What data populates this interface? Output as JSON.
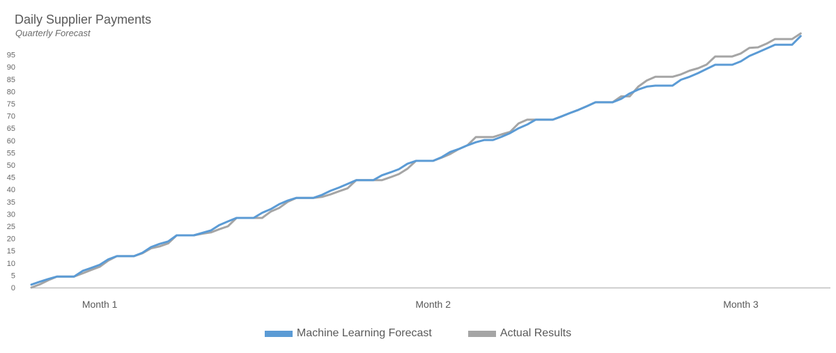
{
  "chart_data": {
    "type": "line",
    "title": "Daily Supplier Payments",
    "subtitle": "Quarterly Forecast",
    "xlabel": "",
    "ylabel": "",
    "ylim": [
      0,
      95
    ],
    "y_ticks": [
      0,
      5,
      10,
      15,
      20,
      25,
      30,
      35,
      40,
      45,
      50,
      55,
      60,
      65,
      70,
      75,
      80,
      85,
      90,
      95
    ],
    "x_tick_labels": [
      {
        "label": "Month 1",
        "day": 8
      },
      {
        "label": "Month 2",
        "day": 47
      },
      {
        "label": "Month 3",
        "day": 83
      }
    ],
    "x": "day 0..90",
    "grid": false,
    "legend_position": "bottom",
    "series": [
      {
        "name": "Machine Learning Forecast",
        "color": "#5b9bd5",
        "values": [
          1.2,
          2.4,
          3.5,
          4.5,
          4.5,
          4.5,
          6.8,
          8.0,
          9.3,
          11.5,
          12.8,
          12.8,
          12.8,
          14.2,
          16.5,
          17.8,
          18.8,
          21.3,
          21.3,
          21.3,
          22.3,
          23.3,
          25.5,
          27.0,
          28.4,
          28.4,
          28.4,
          30.5,
          32.0,
          34.0,
          35.5,
          36.6,
          36.6,
          36.6,
          37.8,
          39.5,
          40.8,
          42.3,
          43.8,
          43.8,
          43.8,
          45.8,
          47.0,
          48.3,
          50.5,
          51.7,
          51.7,
          51.7,
          53.2,
          55.3,
          56.5,
          58.0,
          59.3,
          60.2,
          60.2,
          61.5,
          63.0,
          65.0,
          66.5,
          68.5,
          68.5,
          68.5,
          69.8,
          71.2,
          72.5,
          74.0,
          75.6,
          75.6,
          75.6,
          77.0,
          79.2,
          80.8,
          82.0,
          82.4,
          82.4,
          82.4,
          84.8,
          86.0,
          87.5,
          89.2,
          90.9,
          90.9,
          90.9,
          92.3,
          94.5,
          96.0,
          97.5,
          99.1,
          99.1,
          99.1,
          102.6
        ]
      },
      {
        "name": "Actual Results",
        "color": "#a5a5a5",
        "values": [
          0.0,
          1.3,
          3.0,
          4.5,
          4.5,
          4.5,
          5.8,
          7.2,
          8.5,
          11.0,
          12.8,
          12.8,
          12.8,
          14.0,
          16.0,
          16.8,
          18.0,
          21.3,
          21.3,
          21.3,
          22.0,
          22.5,
          23.8,
          25.0,
          28.4,
          28.4,
          28.4,
          28.4,
          31.0,
          32.5,
          35.0,
          36.6,
          36.6,
          36.6,
          37.0,
          38.0,
          39.3,
          40.5,
          43.8,
          43.8,
          43.8,
          43.8,
          45.0,
          46.3,
          48.5,
          51.7,
          51.7,
          51.7,
          53.0,
          54.5,
          56.5,
          58.0,
          61.4,
          61.4,
          61.4,
          62.5,
          63.5,
          67.0,
          68.5,
          68.5,
          68.5,
          68.5,
          69.8,
          71.2,
          72.5,
          74.0,
          75.6,
          75.6,
          75.6,
          78.0,
          78.0,
          82.0,
          84.5,
          86.0,
          86.0,
          86.0,
          87.0,
          88.5,
          89.5,
          91.0,
          94.3,
          94.3,
          94.3,
          95.5,
          97.8,
          98.0,
          99.5,
          101.4,
          101.4,
          101.4,
          103.7
        ]
      }
    ]
  }
}
